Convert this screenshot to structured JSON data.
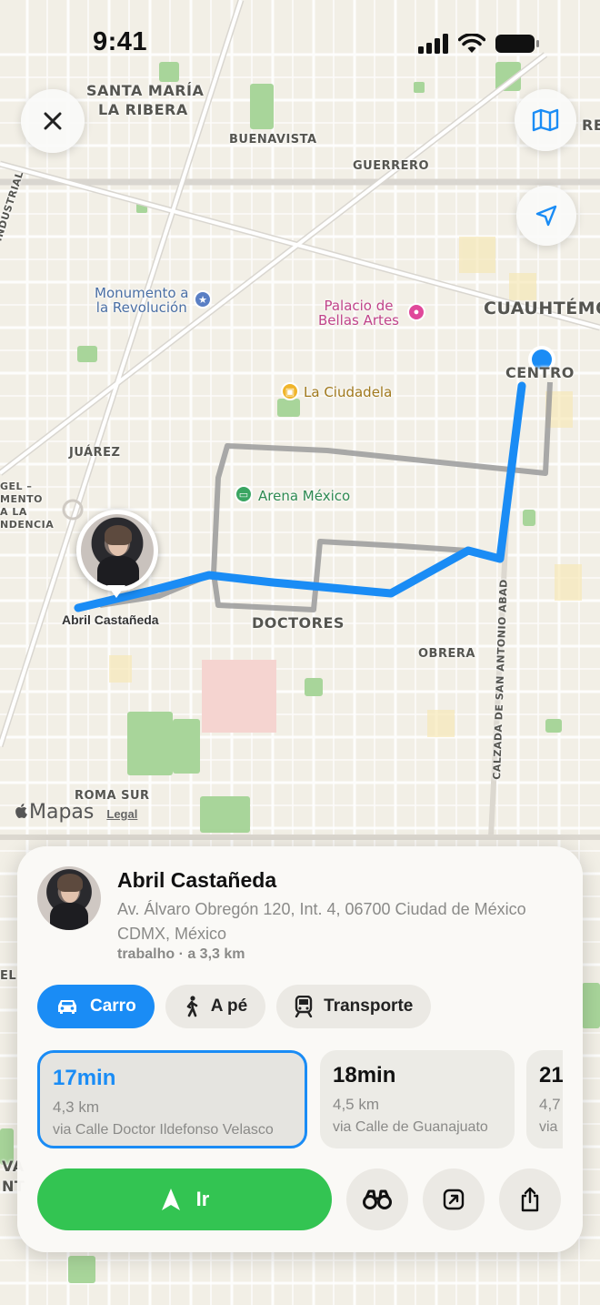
{
  "status_bar": {
    "time": "9:41"
  },
  "map": {
    "labels": {
      "santa_maria": "SANTA MARÍA",
      "la_ribera": "LA RIBERA",
      "buenavista": "BUENAVISTA",
      "guerrero": "GUERRERO",
      "cuauhtemoc": "CUAUHTÉMOC",
      "centro": "CENTRO",
      "juarez": "JUÁREZ",
      "doctores": "DOCTORES",
      "obrera": "OBRERA",
      "roma_sur": "ROMA SUR",
      "industrial": "INDUSTRIAL",
      "calzada": "CALZADA DE SAN ANTONIO ABAD",
      "gel_1": "GEL –",
      "mento": "MENTO",
      "la": "A LA",
      "ndencia": "NDENCIA",
      "re": "RE",
      "el": "EL",
      "va": "VA",
      "nt": "NT"
    },
    "pois": {
      "monumento_1": "Monumento a",
      "monumento_2": "la Revolución",
      "palacio_1": "Palacio de",
      "palacio_2": "Bellas Artes",
      "ciudadela": "La Ciudadela",
      "arena": "Arena México"
    },
    "pin_name": "Abril Castañeda",
    "attribution": "Mapas",
    "legal": "Legal",
    "colors": {
      "route": "#1a8cf5",
      "alt_route": "#9b9b9b",
      "park": "#a8d59a"
    }
  },
  "sheet": {
    "name": "Abril Castañeda",
    "address": "Av. Álvaro Obregón 120, Int. 4, 06700 Ciudad de México CDMX, México",
    "meta": "trabalho · a 3,3 km",
    "modes": [
      {
        "label": "Carro",
        "icon": "car-icon",
        "active": true
      },
      {
        "label": "A pé",
        "icon": "walk-icon",
        "active": false
      },
      {
        "label": "Transporte",
        "icon": "train-icon",
        "active": false
      }
    ],
    "routes": [
      {
        "time": "17min",
        "distance": "4,3 km",
        "via": "via Calle Doctor Ildefonso Velasco",
        "selected": true
      },
      {
        "time": "18min",
        "distance": "4,5 km",
        "via": "via Calle de Guanajuato",
        "selected": false
      },
      {
        "time": "21",
        "distance": "4,7",
        "via": "via",
        "selected": false
      }
    ],
    "go_label": "Ir"
  }
}
